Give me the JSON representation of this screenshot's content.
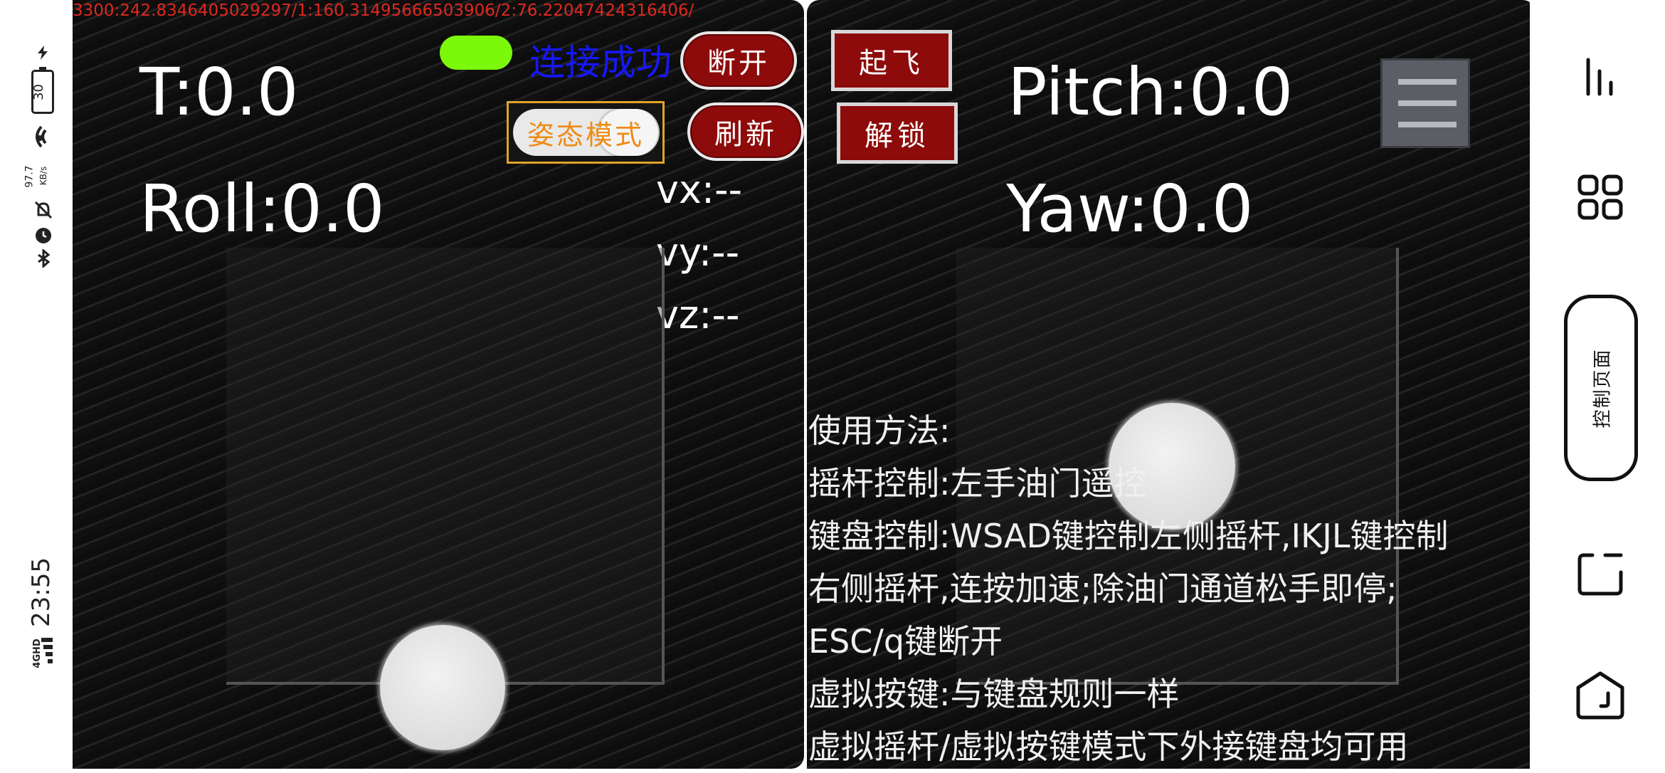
{
  "status_bar": {
    "clock": "23:55",
    "network": "4GHD",
    "speed_value": "97.7",
    "speed_unit": "KB/s",
    "battery": "30",
    "icons": [
      "charging-icon",
      "battery-icon",
      "wifi-icon",
      "network-speed-icon",
      "mute-icon",
      "alarm-icon",
      "bluetooth-icon",
      "signal-icon"
    ]
  },
  "debug_text": "3300:242.8346405029297/1:160.31495666503906/2:76.22047424316406/",
  "left": {
    "throttle": "T:0.0",
    "roll": "Roll:0.0",
    "vx": "vx:--",
    "vy": "vy:--",
    "vz": "vz:--",
    "connection_status": "连接成功",
    "disconnect_label": "断开",
    "refresh_label": "刷新",
    "mode_label": "姿态模式"
  },
  "right": {
    "pitch": "Pitch:0.0",
    "yaw": "Yaw:0.0",
    "takeoff_label": "起飞",
    "unlock_label": "解锁",
    "menu_icon": "hamburger-menu-icon",
    "instructions": [
      "使用方法:",
      "摇杆控制:左手油门遥控",
      "键盘控制:WSAD键控制左侧摇杆,IKJL键控制",
      "右侧摇杆,连按加速;除油门通道松手即停;",
      "ESC/q键断开",
      "虚拟按键:与键盘规则一样",
      "虚拟摇杆/虚拟按键模式下外接键盘均可用"
    ]
  },
  "nav": {
    "control_page_label": "控制页面",
    "icons": [
      "recent-apps-icon",
      "grid-apps-icon",
      "rotate-screen-icon",
      "back-icon"
    ]
  },
  "colors": {
    "connected_led": "#7cf80a",
    "connect_text": "#1717ff",
    "button_red": "#8e0b0b",
    "debug_red": "#e0281f",
    "mode_orange": "#ef8b15"
  }
}
